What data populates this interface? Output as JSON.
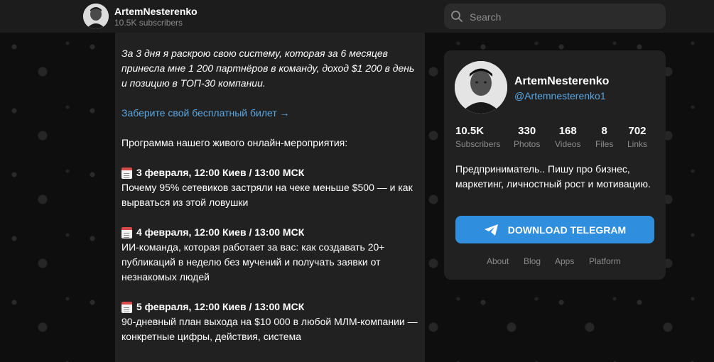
{
  "header": {
    "channel_name": "ArtemNesterenko",
    "subscribers": "10.5K subscribers",
    "search_placeholder": "Search"
  },
  "post": {
    "intro": "За 3 дня я раскрою свою систему, которая за 6 месяцев принесла мне 1 200 партнёров в команду, доход $1 200 в день и позицию в ТОП-30 компании.",
    "link": "Заберите свой бесплатный билет →",
    "program_title": "Программа нашего живого онлайн-мероприятия:",
    "events": [
      {
        "date": "3 февраля, 12:00 Киев / 13:00 МСК",
        "text": "Почему 95% сетевиков застряли на чеке меньше $500 — и как вырваться из этой ловушки"
      },
      {
        "date": "4 февраля, 12:00 Киев / 13:00 МСК",
        "text": "ИИ-команда, которая работает за вас: как создавать 20+ публикаций в неделю без мучений и получать заявки от незнакомых людей"
      },
      {
        "date": "5 февраля, 12:00 Киев / 13:00 МСК",
        "text": "90-дневный план выхода на $10 000 в любой МЛМ-компании — конкретные цифры, действия, система"
      }
    ]
  },
  "card": {
    "name": "ArtemNesterenko",
    "handle": "@Artemnesterenko1",
    "stats": [
      {
        "num": "10.5K",
        "label": "Subscribers"
      },
      {
        "num": "330",
        "label": "Photos"
      },
      {
        "num": "168",
        "label": "Videos"
      },
      {
        "num": "8",
        "label": "Files"
      },
      {
        "num": "702",
        "label": "Links"
      }
    ],
    "description": "Предприниматель.. Пишу про бизнес, маркетинг, личностный рост и мотивацию.",
    "download_label": "DOWNLOAD TELEGRAM",
    "footer_links": [
      "About",
      "Blog",
      "Apps",
      "Platform"
    ]
  },
  "colors": {
    "accent": "#2f8fde",
    "link": "#5aa7e3",
    "panel": "#212121"
  }
}
